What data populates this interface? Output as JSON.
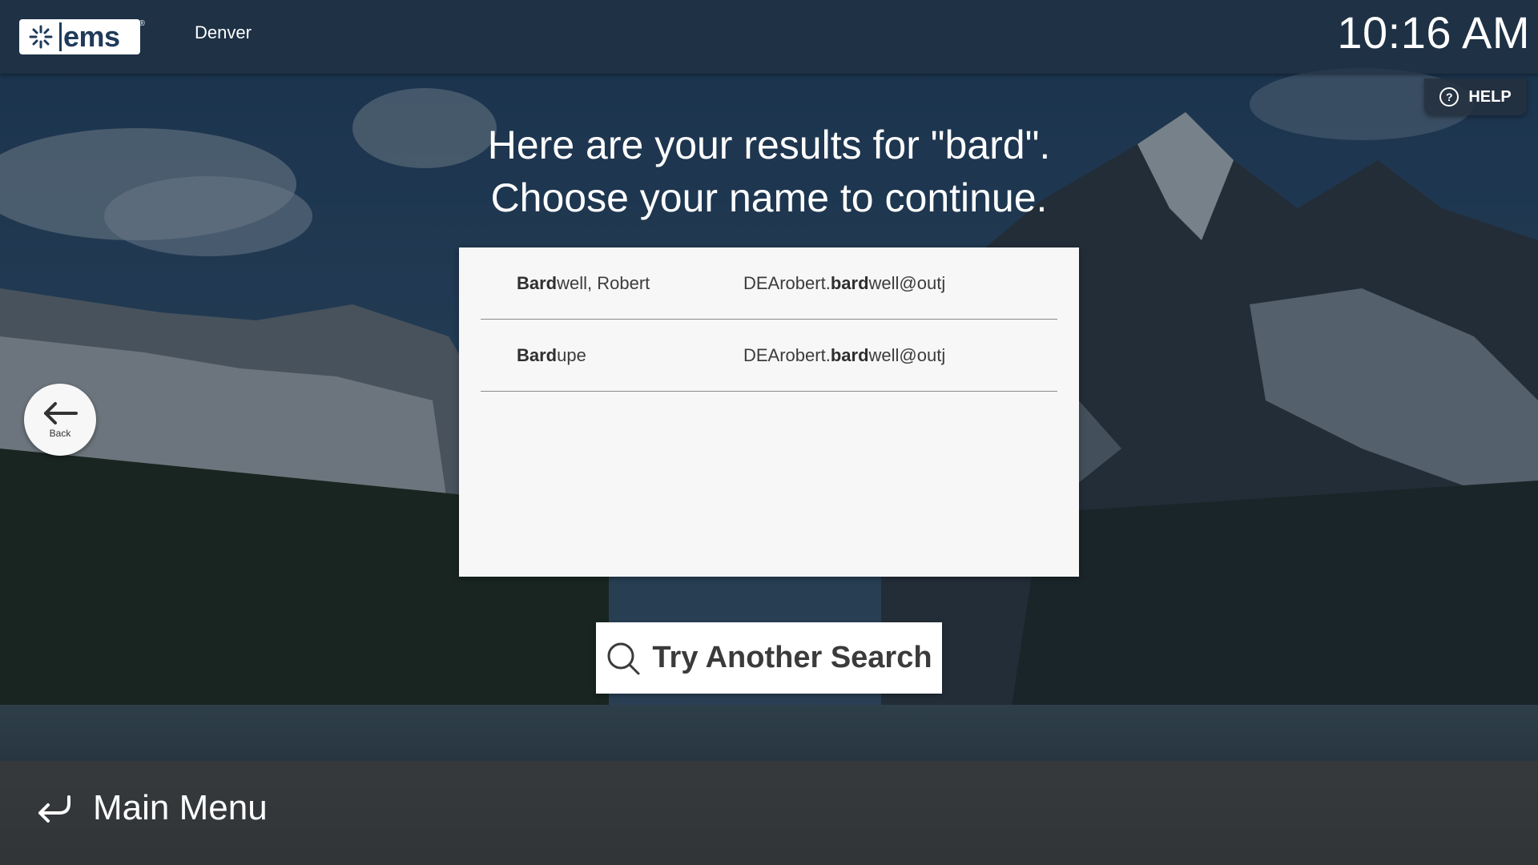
{
  "header": {
    "logo_text": "ems",
    "logo_reg": "®",
    "location": "Denver",
    "clock": "10:16 AM"
  },
  "help": {
    "label": "HELP",
    "icon": "question-circle-icon"
  },
  "prompt": {
    "line1": "Here are your results for \"bard\".",
    "line2": "Choose your name to continue."
  },
  "results": [
    {
      "name_match": "Bard",
      "name_rest": "well, Robert",
      "email_prefix": "DEArobert.",
      "email_match": "bard",
      "email_rest": "well@outj"
    },
    {
      "name_match": "Bard",
      "name_rest": "upe",
      "email_prefix": "DEArobert.",
      "email_match": "bard",
      "email_rest": "well@outj"
    }
  ],
  "back": {
    "label": "Back",
    "icon": "arrow-left-icon"
  },
  "search": {
    "label": "Try Another Search",
    "icon": "search-icon"
  },
  "footer": {
    "main_menu_label": "Main Menu",
    "icon": "return-arrow-icon"
  },
  "colors": {
    "panel_bg": "#f7f7f7",
    "bar_bg": "#203042",
    "accent": "#1f3a5a"
  }
}
